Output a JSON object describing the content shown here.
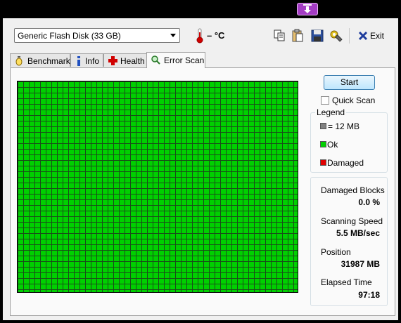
{
  "toolbar": {
    "drive_value": "Generic Flash Disk (33 GB)",
    "temperature": "– °C",
    "exit_label": "Exit"
  },
  "tabs": [
    {
      "label": "Benchmark",
      "icon": "stopwatch-icon"
    },
    {
      "label": "Info",
      "icon": "info-icon"
    },
    {
      "label": "Health",
      "icon": "health-cross-icon"
    },
    {
      "label": "Error Scan",
      "icon": "magnifier-icon",
      "active": true
    }
  ],
  "scan": {
    "start_label": "Start",
    "quick_scan_label": "Quick Scan",
    "quick_scan_checked": false
  },
  "legend": {
    "title": "Legend",
    "block_size": "= 12 MB",
    "ok": "Ok",
    "damaged": "Damaged",
    "colors": {
      "block": "#808080",
      "ok": "#00d000",
      "damaged": "#e00000"
    }
  },
  "stats": {
    "damaged_blocks_label": "Damaged Blocks",
    "damaged_blocks_value": "0.0 %",
    "scanning_speed_label": "Scanning Speed",
    "scanning_speed_value": "5.5 MB/sec",
    "position_label": "Position",
    "position_value": "31987 MB",
    "elapsed_label": "Elapsed Time",
    "elapsed_value": "97:18"
  }
}
